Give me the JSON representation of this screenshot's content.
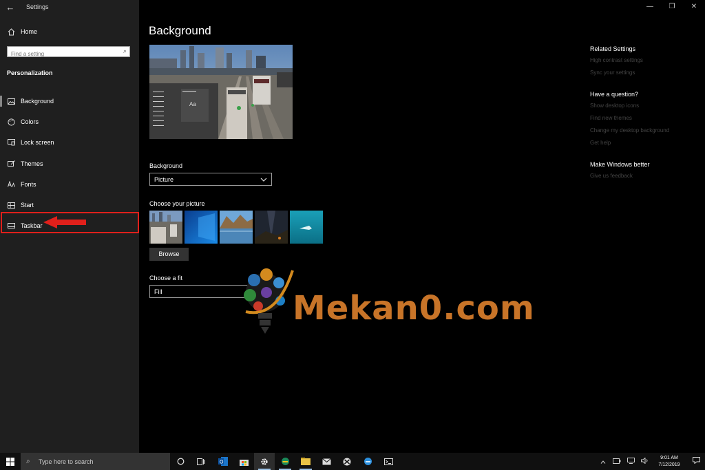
{
  "titlebar": {
    "back": "←",
    "title": "Settings"
  },
  "window_controls": {
    "minimize": "—",
    "maximize": "❐",
    "close": "✕"
  },
  "sidebar": {
    "home_label": "Home",
    "search_placeholder": "Find a setting",
    "section_heading": "Personalization",
    "items": [
      {
        "label": "Background",
        "icon": "picture-icon"
      },
      {
        "label": "Colors",
        "icon": "palette-icon"
      },
      {
        "label": "Lock screen",
        "icon": "lock-screen-icon"
      },
      {
        "label": "Themes",
        "icon": "brush-icon"
      },
      {
        "label": "Fonts",
        "icon": "font-icon"
      },
      {
        "label": "Start",
        "icon": "start-grid-icon"
      },
      {
        "label": "Taskbar",
        "icon": "taskbar-icon"
      }
    ],
    "highlight_color": "#e0201b"
  },
  "main": {
    "title": "Background",
    "preview_sample_text": "Aa",
    "background_label": "Background",
    "background_value": "Picture",
    "choose_picture_label": "Choose your picture",
    "browse_label": "Browse",
    "choose_fit_label": "Choose a fit",
    "fit_value": "Fill"
  },
  "related": {
    "groups": [
      {
        "heading": "Related Settings",
        "links": [
          "High contrast settings",
          "Sync your settings"
        ]
      },
      {
        "heading": "Have a question?",
        "links": [
          "Show desktop icons",
          "Find new themes",
          "Change my desktop background",
          "Get help"
        ]
      },
      {
        "heading": "Make Windows better",
        "links": [
          "Give us feedback"
        ]
      }
    ]
  },
  "watermark": {
    "text": "Mekan0.com",
    "color": "#c87428"
  },
  "taskbar": {
    "search_placeholder": "Type here to search",
    "time": "9:01 AM",
    "date": "7/12/2019"
  }
}
